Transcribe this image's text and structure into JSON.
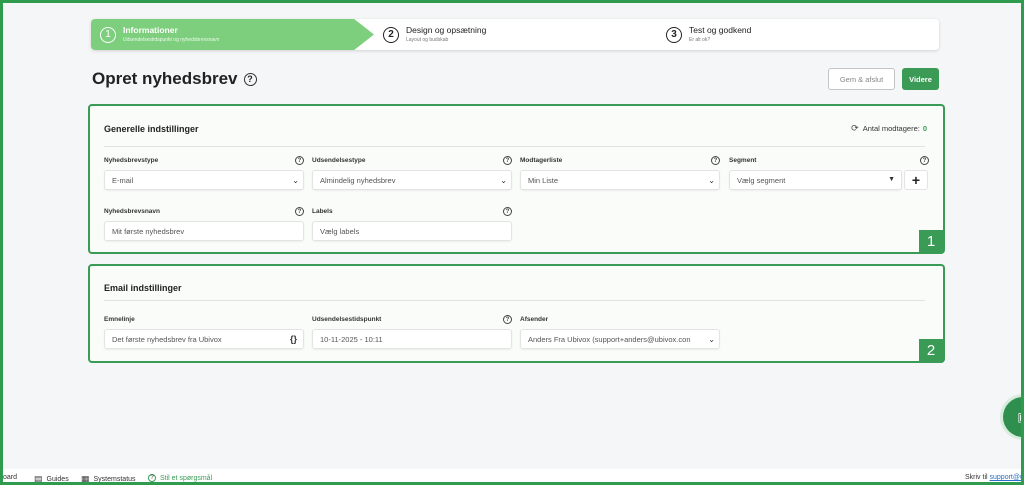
{
  "stepper": [
    {
      "num": "1",
      "title": "Informationer",
      "sub": "Udsendelsestidspunkt og nyhedsbrevsnavn"
    },
    {
      "num": "2",
      "title": "Design og opsætning",
      "sub": "Layout og budskab"
    },
    {
      "num": "3",
      "title": "Test og godkend",
      "sub": "Er alt ok?"
    }
  ],
  "header": {
    "title": "Opret nyhedsbrev",
    "help_icon": "?",
    "save_label": "Gem & afslut",
    "next_label": "Videre"
  },
  "general": {
    "title": "Generelle indstillinger",
    "recipients_label": "Antal modtagere:",
    "recipients_count": "0",
    "badge": "1",
    "fields": {
      "type": {
        "label": "Nyhedsbrevstype",
        "value": "E-mail"
      },
      "sendtype": {
        "label": "Udsendelsestype",
        "value": "Almindelig nyhedsbrev"
      },
      "list": {
        "label": "Modtagerliste",
        "value": "Min Liste"
      },
      "segment": {
        "label": "Segment",
        "value": "Vælg segment"
      },
      "name": {
        "label": "Nyhedsbrevsnavn",
        "value": "Mit første nyhedsbrev"
      },
      "labels": {
        "label": "Labels",
        "value": "Vælg labels"
      }
    }
  },
  "email": {
    "title": "Email indstillinger",
    "badge": "2",
    "fields": {
      "subject": {
        "label": "Emnelinje",
        "value": "Det første nyhedsbrev fra Ubivox"
      },
      "sendtime": {
        "label": "Udsendelsestidspunkt",
        "value": "10-11-2025 - 10:11"
      },
      "sender": {
        "label": "Afsender",
        "value": "Anders Fra Ubivox (support+anders@ubivox.con"
      }
    }
  },
  "bottom_bar": {
    "dashboard": "oard",
    "guides": "Guides",
    "status": "Systemstatus",
    "ask": "Stil et spørgsmål",
    "write_to": "Skriv til",
    "support_link": "support@u"
  },
  "icons": {
    "help": "help-circle-icon",
    "refresh": "refresh-icon",
    "chevron": "chevron-down-icon",
    "plus": "plus-icon",
    "braces": "curly-braces-icon",
    "chat": "chat-icon"
  },
  "colors": {
    "accent": "#3a9b56",
    "step_active": "#7dcf7d",
    "link": "#2a6fc9"
  }
}
